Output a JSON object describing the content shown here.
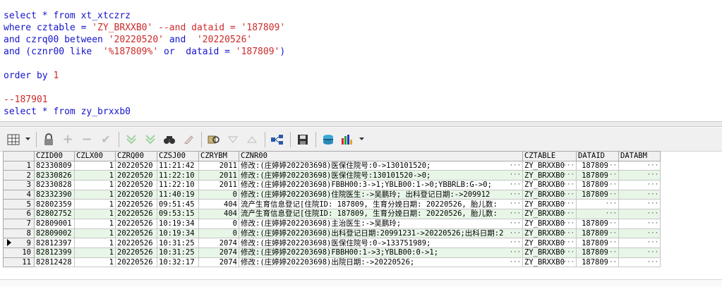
{
  "editor": {
    "lines": [
      [
        {
          "t": "select * from xt_xtczrz",
          "c": "kw"
        }
      ],
      [
        {
          "t": "where cztable = ",
          "c": "kw"
        },
        {
          "t": "'ZY_BRXXB0'",
          "c": "str"
        },
        {
          "t": " --and dataid = ",
          "c": "cmt"
        },
        {
          "t": "'187809'",
          "c": "str"
        }
      ],
      [
        {
          "t": "and czrq00 between ",
          "c": "kw"
        },
        {
          "t": "'20220520'",
          "c": "str"
        },
        {
          "t": " and  ",
          "c": "kw"
        },
        {
          "t": "'20220526'",
          "c": "str"
        }
      ],
      [
        {
          "t": "and (cznr00 like  ",
          "c": "kw"
        },
        {
          "t": "'%187809%'",
          "c": "str"
        },
        {
          "t": " or  dataid = ",
          "c": "kw"
        },
        {
          "t": "'187809'",
          "c": "str"
        },
        {
          "t": ")",
          "c": "kw"
        }
      ],
      [],
      [
        {
          "t": "order by ",
          "c": "kw"
        },
        {
          "t": "1",
          "c": "num"
        }
      ],
      [],
      [
        {
          "t": "--187901",
          "c": "cmt"
        }
      ],
      [
        {
          "t": "select * from zy_brxxb0",
          "c": "kw"
        }
      ]
    ]
  },
  "toolbar": {
    "icons": [
      "grid-view-icon",
      "lock-icon",
      "add-record-icon",
      "delete-record-icon",
      "post-icon",
      "filter-down-icon",
      "filter-clear-icon",
      "find-icon",
      "clear-icon",
      "query-by-example-icon",
      "sort-down-icon",
      "sort-up-icon",
      "export-icon",
      "save-icon",
      "print-icon",
      "chart-icon"
    ]
  },
  "grid": {
    "columns": [
      "CZID00",
      "CZLX00",
      "CZRQ00",
      "CZSJ00",
      "CZRYBM",
      "CZNR00",
      "CZTABLE",
      "DATAID",
      "DATABM"
    ],
    "rows": [
      [
        "82330809",
        "1",
        "20220520",
        "11:21:42",
        "2011",
        "修改:(庄婷婷202203698)医保住院号:0->130101520;",
        "ZY_BRXXB0",
        "187809",
        ""
      ],
      [
        "82330826",
        "1",
        "20220520",
        "11:22:10",
        "2011",
        "修改:(庄婷婷202203698)医保住院号:130101520->0;",
        "ZY_BRXXB0",
        "187809",
        ""
      ],
      [
        "82330828",
        "1",
        "20220520",
        "11:22:10",
        "2011",
        "修改:(庄婷婷202203698)FBBH00:3->1;YBLB00:1->0;YBBRLB:G->0;",
        "ZY_BRXXB0",
        "187809",
        ""
      ],
      [
        "82332390",
        "1",
        "20220520",
        "11:40:19",
        "0",
        "修改:(庄婷婷202203698)住院医生:->吴鹏玲;  出科登记日期:->209912",
        "ZY_BRXXB0",
        "187809",
        ""
      ],
      [
        "82802359",
        "1",
        "20220526",
        "09:51:45",
        "404",
        "流产生育信息登记[住院ID: 187809, 生育分娩日期: 20220526, 胎儿数:",
        "ZY_BRXXB0",
        "",
        ""
      ],
      [
        "82802752",
        "1",
        "20220526",
        "09:53:15",
        "404",
        "流产生育信息登记[住院ID: 187809, 生育分娩日期: 20220526, 胎儿数:",
        "ZY_BRXXB0",
        "",
        ""
      ],
      [
        "82809001",
        "1",
        "20220526",
        "10:19:34",
        "0",
        "修改:(庄婷婷202203698)主治医生:->吴鹏玲;",
        "ZY_BRXXB0",
        "187809",
        ""
      ],
      [
        "82809002",
        "1",
        "20220526",
        "10:19:34",
        "0",
        "修改:(庄婷婷202203698)出科登记日期:20991231->20220526;出科日期:2",
        "ZY_BRXXB0",
        "187809",
        ""
      ],
      [
        "82812397",
        "1",
        "20220526",
        "10:31:25",
        "2074",
        "修改:(庄婷婷202203698)医保住院号:0->133751989;",
        "ZY_BRXXB0",
        "187809",
        ""
      ],
      [
        "82812399",
        "1",
        "20220526",
        "10:31:25",
        "2074",
        "修改:(庄婷婷202203698)FBBH00:1->3;YBLB00:0->1;",
        "ZY_BRXXB0",
        "187809",
        ""
      ],
      [
        "82812428",
        "1",
        "20220526",
        "10:32:17",
        "2074",
        "修改:(庄婷婷202203698)出院日期:->20220526;",
        "ZY_BRXXB0",
        "187809",
        ""
      ]
    ],
    "current_row": 9
  }
}
